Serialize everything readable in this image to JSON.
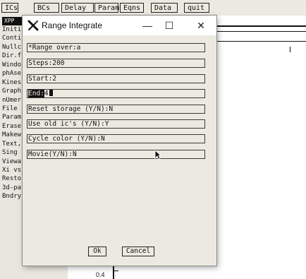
{
  "menubar": {
    "buttons": [
      "ICs",
      "BCs",
      "Delay",
      "Param",
      "Eqns",
      "Data",
      "quit"
    ]
  },
  "main_window": {
    "title": "XPP",
    "menu_items": [
      "Initi",
      "Conti",
      "Nullc",
      "Dir.f",
      "Windo",
      "phAse",
      "Kines",
      "Graph",
      "nUmer",
      "File",
      "Param",
      "Erase",
      "Makew",
      "Text,",
      "Sing",
      "Viewa",
      "Xi vs",
      "Resto",
      "3d-pa",
      "Bndry"
    ]
  },
  "plot": {
    "tick_label": "0.4"
  },
  "dialog": {
    "title": "Range Integrate",
    "controls": {
      "minimize": "—",
      "maximize": "☐",
      "close": "✕"
    },
    "fields": [
      {
        "label": "*Range over",
        "value": "a"
      },
      {
        "label": "Steps",
        "value": "200"
      },
      {
        "label": "Start",
        "value": "2"
      },
      {
        "label": "End",
        "value": "4"
      },
      {
        "label": "Reset storage (Y/N)",
        "value": "N"
      },
      {
        "label": "Use old ic's (Y/N)",
        "value": "Y"
      },
      {
        "label": "Cycle color (Y/N)",
        "value": "N"
      },
      {
        "label": "Movie(Y/N)",
        "value": "N"
      }
    ],
    "ok_label": "Ok",
    "cancel_label": "Cancel"
  },
  "colors": {
    "panel": "#ece9e0",
    "text": "#111111",
    "titlebar": "#ffffff",
    "border": "#3a3a3a"
  }
}
